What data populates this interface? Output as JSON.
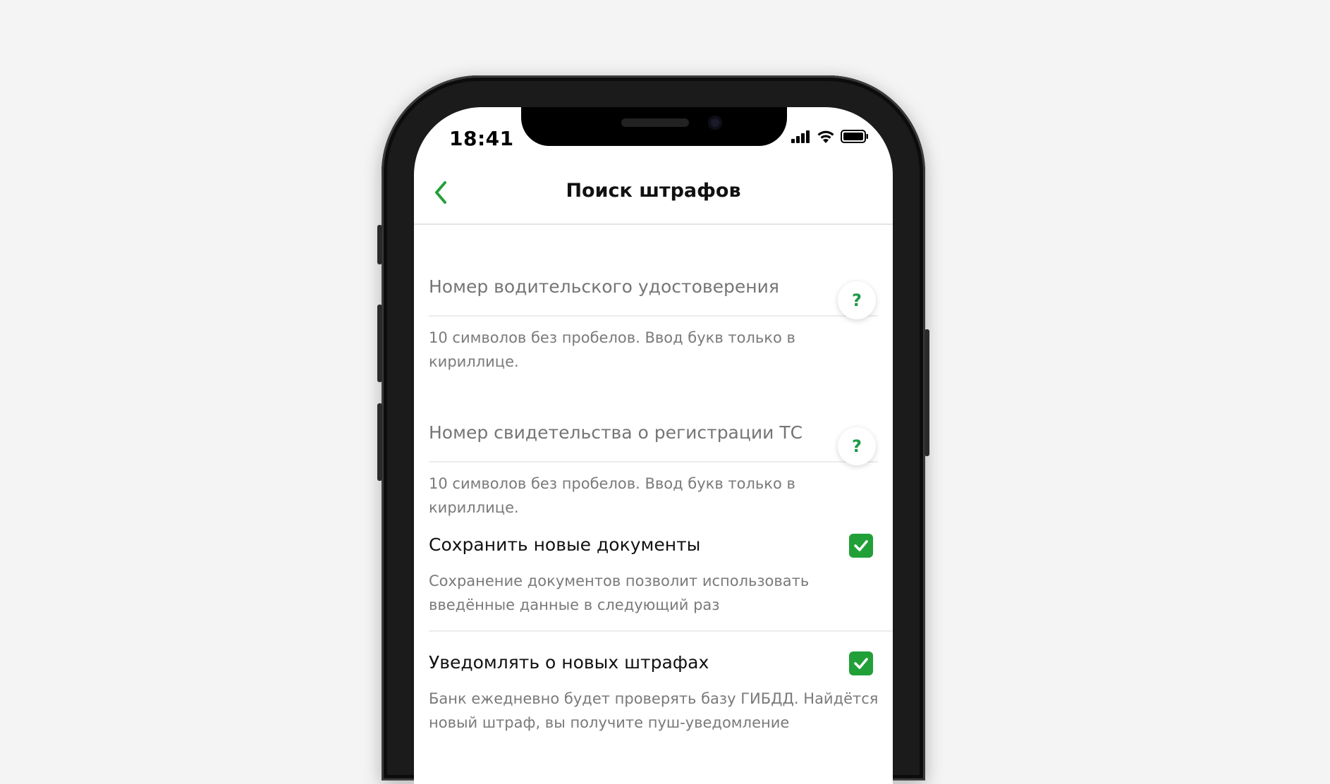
{
  "status_bar": {
    "time": "18:41"
  },
  "header": {
    "title": "Поиск штрафов"
  },
  "fields": [
    {
      "label": "Номер водительского удостоверения",
      "hint": "10 символов без пробелов. Ввод букв только в кириллице.",
      "help": "?"
    },
    {
      "label": "Номер свидетельства о регистрации ТС",
      "hint": "10 символов без пробелов. Ввод букв только в кириллице.",
      "help": "?"
    }
  ],
  "options": [
    {
      "title": "Сохранить новые документы",
      "description": "Сохранение документов позволит использовать введённые данные в следующий раз",
      "checked": true
    },
    {
      "title": "Уведомлять о новых штрафах",
      "description": "Банк ежедневно будет проверять базу ГИБДД. Найдётся новый штраф, вы получите пуш-уведомление",
      "checked": true
    }
  ],
  "colors": {
    "accent": "#21a038",
    "help_mark": "#1f9a4a",
    "background": "#f4f4f4"
  }
}
